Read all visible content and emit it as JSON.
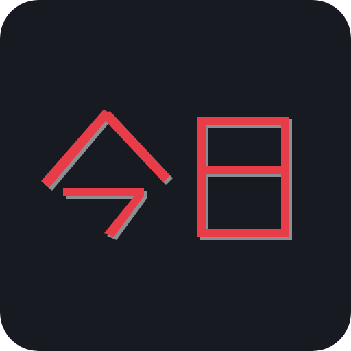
{
  "app_icon": {
    "label": "今日",
    "colors": {
      "background": "#171b21",
      "glyph": "#e83d4a",
      "shadow": "#8a8f94"
    }
  }
}
